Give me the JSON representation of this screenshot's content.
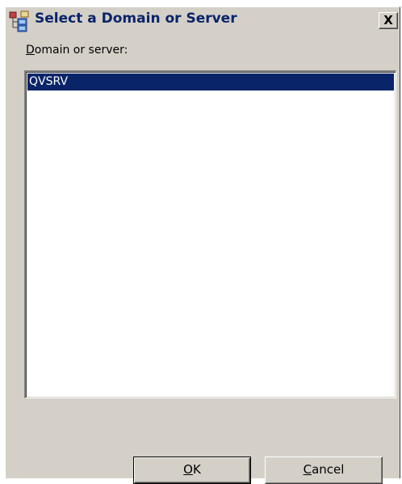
{
  "window": {
    "title": "Select a Domain or Server",
    "close_label": "X",
    "icon": "domain-tree-icon"
  },
  "field": {
    "label_accel": "D",
    "label_rest": "omain or server:"
  },
  "list": {
    "items": [
      {
        "label": "QVSRV",
        "selected": true
      }
    ]
  },
  "buttons": {
    "ok_accel": "O",
    "ok_rest": "K",
    "cancel_accel": "C",
    "cancel_rest": "ancel"
  },
  "colors": {
    "face": "#d4d0c8",
    "selection": "#0a246a",
    "title_text": "#0a246a"
  }
}
